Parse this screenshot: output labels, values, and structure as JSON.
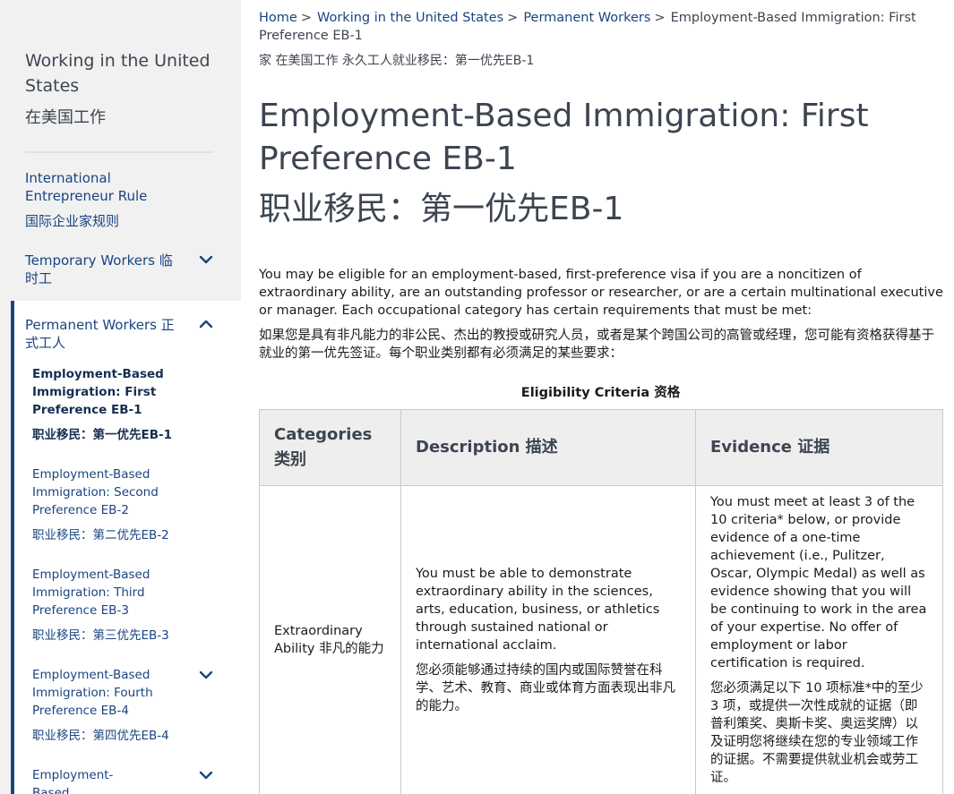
{
  "sidebar": {
    "title": "Working in the United States",
    "title_cn": "在美国工作",
    "items": [
      {
        "label": "International Entrepreneur Rule",
        "label_cn": "国际企业家规则"
      },
      {
        "label": "Temporary Workers 临时工"
      },
      {
        "label": "Permanent Workers 正式工人"
      }
    ],
    "subitems": [
      {
        "label": "Employment-Based Immigration: First Preference EB-1",
        "label_cn": "职业移民：第一优先EB-1"
      },
      {
        "label": "Employment-Based Immigration: Second Preference EB-2",
        "label_cn": "职业移民：第二优先EB-2"
      },
      {
        "label": "Employment-Based Immigration: Third Preference EB-3",
        "label_cn": "职业移民：第三优先EB-3"
      },
      {
        "label": "Employment-Based Immigration: Fourth Preference EB-4",
        "label_cn": "职业移民：第四优先EB-4"
      },
      {
        "label": "Employment-Based Immigration: Fifth"
      }
    ]
  },
  "breadcrumb": {
    "home": "Home",
    "working": "Working in the United States",
    "permanent": "Permanent Workers",
    "current": "Employment-Based Immigration: First Preference EB-1",
    "cn": "家 在美国工作 永久工人就业移民：第一优先EB-1",
    "separator": ">"
  },
  "page": {
    "title": "Employment-Based Immigration: First Preference EB-1",
    "title_cn": "职业移民：第一优先EB-1",
    "intro": "You may be eligible for an employment-based, first-preference visa if you are a noncitizen of extraordinary ability, are an outstanding professor or researcher, or are a certain multinational executive or manager. Each occupational category has certain requirements that must be met:",
    "intro_cn": "如果您是具有非凡能力的非公民、杰出的教授或研究人员，或者是某个跨国公司的高管或经理，您可能有资格获得基于就业的第一优先签证。每个职业类别都有必须满足的某些要求："
  },
  "table": {
    "caption": "Eligibility Criteria 资格",
    "headers": [
      "Categories 类别",
      "Description 描述",
      "Evidence 证据"
    ],
    "rows": [
      {
        "category": "Extraordinary Ability 非凡的能力",
        "description": "You must be able to demonstrate extraordinary ability in the sciences, arts, education, business, or athletics through sustained national or international acclaim.",
        "description_cn": "您必须能够通过持续的国内或国际赞誉在科学、艺术、教育、商业或体育方面表现出非凡的能力。",
        "evidence": "You must meet at least 3 of the 10 criteria* below, or provide evidence of a one-time achievement (i.e., Pulitzer, Oscar, Olympic Medal) as well as evidence showing that you will be continuing to work in the area of your expertise. No offer of employment or labor certification is required.",
        "evidence_cn": "您必须满足以下 10 项标准*中的至少 3 项，或提供一次性成就的证据（即普利策奖、奥斯卡奖、奥运奖牌）以及证明您将继续在您的专业领域工作的证据。不需要提供就业机会或劳工证。"
      }
    ]
  },
  "icons": {
    "chevron_down": "chevron-down-icon",
    "chevron_up": "chevron-up-icon"
  },
  "colors": {
    "link": "#1a4480",
    "sidebar_bg": "#f1f1f1",
    "accent_bar": "#1a4480",
    "table_header_bg": "#eeeeee"
  }
}
